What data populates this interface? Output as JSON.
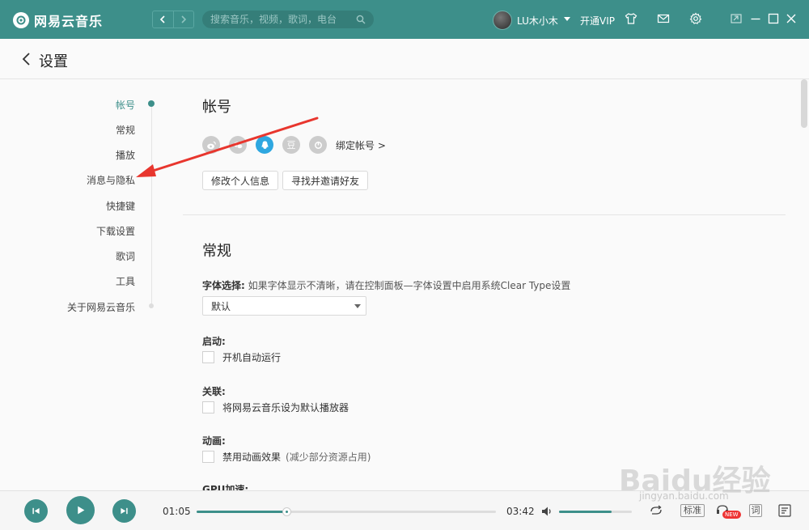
{
  "app": {
    "name": "网易云音乐",
    "search_placeholder": "搜索音乐，视频，歌词，电台",
    "username": "LU木小木",
    "vip_label": "开通VIP",
    "brand_color": "#3d8f8a"
  },
  "header": {
    "title": "设置"
  },
  "nav": {
    "items": [
      {
        "label": "帐号",
        "active": true
      },
      {
        "label": "常规"
      },
      {
        "label": "播放"
      },
      {
        "label": "消息与隐私"
      },
      {
        "label": "快捷键"
      },
      {
        "label": "下载设置"
      },
      {
        "label": "歌词"
      },
      {
        "label": "工具"
      },
      {
        "label": "关于网易云音乐"
      }
    ]
  },
  "account": {
    "title": "帐号",
    "social_icons": [
      "weibo-icon",
      "wechat-icon",
      "qq-icon",
      "douban-icon",
      "netease-icon"
    ],
    "douban_glyph": "豆",
    "bind_link": "绑定帐号 >",
    "edit_profile": "修改个人信息",
    "find_friends": "寻找并邀请好友"
  },
  "general": {
    "title": "常规",
    "font_label": "字体选择:",
    "font_hint": "如果字体显示不清晰，请在控制面板—字体设置中启用系统Clear Type设置",
    "font_value": "默认",
    "startup_label": "启动:",
    "startup_option": "开机自动运行",
    "assoc_label": "关联:",
    "assoc_option": "将网易云音乐设为默认播放器",
    "anim_label": "动画:",
    "anim_option": "禁用动画效果",
    "anim_sub": "(减少部分资源占用)",
    "gpu_label": "GPU加速:"
  },
  "player": {
    "current_time": "01:05",
    "total_time": "03:42",
    "progress": 0.3,
    "volume": 0.72,
    "quality": "标准",
    "new_badge": "NEW",
    "lyric": "词"
  },
  "watermark": {
    "text": "Baidu经验",
    "url": "jingyan.baidu.com"
  }
}
